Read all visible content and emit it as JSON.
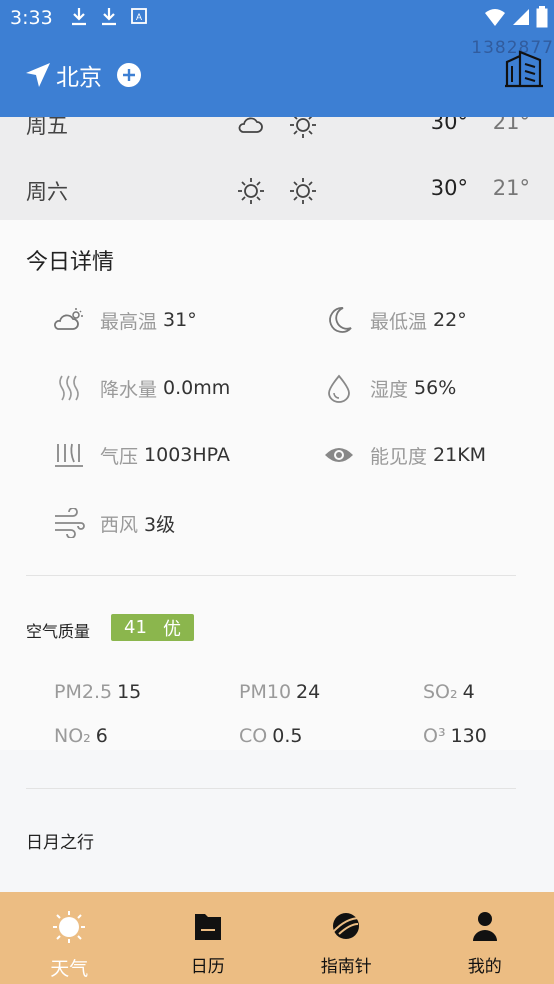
{
  "status_bar": {
    "time": "3:33"
  },
  "header": {
    "city": "北京",
    "faded_text": "1382877",
    "icons": [
      "location-arrow-icon",
      "add-circle-icon",
      "buildings-icon"
    ]
  },
  "forecast": [
    {
      "day": "周五",
      "icon_day": "cloud-sun-icon",
      "icon_night": "sun-icon",
      "high": "30°",
      "low": "21°"
    },
    {
      "day": "周六",
      "icon_day": "sun-icon",
      "icon_night": "sun-icon",
      "high": "30°",
      "low": "21°"
    }
  ],
  "details": {
    "title": "今日详情",
    "items": [
      {
        "label": "最高温",
        "value": "31°",
        "icon": "cloud-sun-icon"
      },
      {
        "label": "最低温",
        "value": "22°",
        "icon": "moon-icon"
      },
      {
        "label": "降水量",
        "value": "0.0mm",
        "icon": "rain-icon"
      },
      {
        "label": "湿度",
        "value": "56%",
        "icon": "droplet-icon"
      },
      {
        "label": "气压",
        "value": "1003HPA",
        "icon": "pressure-icon"
      },
      {
        "label": "能见度",
        "value": "21KM",
        "icon": "eye-icon"
      },
      {
        "label": "西风",
        "value": "3级",
        "icon": "wind-icon"
      }
    ]
  },
  "air_quality": {
    "title": "空气质量",
    "aqi": "41",
    "level": "优",
    "badge_color": "#8bb64d",
    "items": [
      {
        "key": "PM2.5",
        "value": "15"
      },
      {
        "key": "PM10",
        "value": "24"
      },
      {
        "key": "SO₂",
        "value": "4"
      },
      {
        "key": "NO₂",
        "value": "6"
      },
      {
        "key": "CO",
        "value": "0.5"
      },
      {
        "key": "O³",
        "value": "130"
      }
    ]
  },
  "sun_moon": {
    "title": "日月之行"
  },
  "nav": {
    "items": [
      {
        "label": "天气",
        "icon": "sun-icon",
        "active": true
      },
      {
        "label": "日历",
        "icon": "calendar-icon",
        "active": false
      },
      {
        "label": "指南针",
        "icon": "compass-icon",
        "active": false
      },
      {
        "label": "我的",
        "icon": "user-icon",
        "active": false
      }
    ]
  },
  "colors": {
    "header": "#3d7fd3",
    "nav": "#ecbd83",
    "aq_badge": "#8bb64d"
  }
}
